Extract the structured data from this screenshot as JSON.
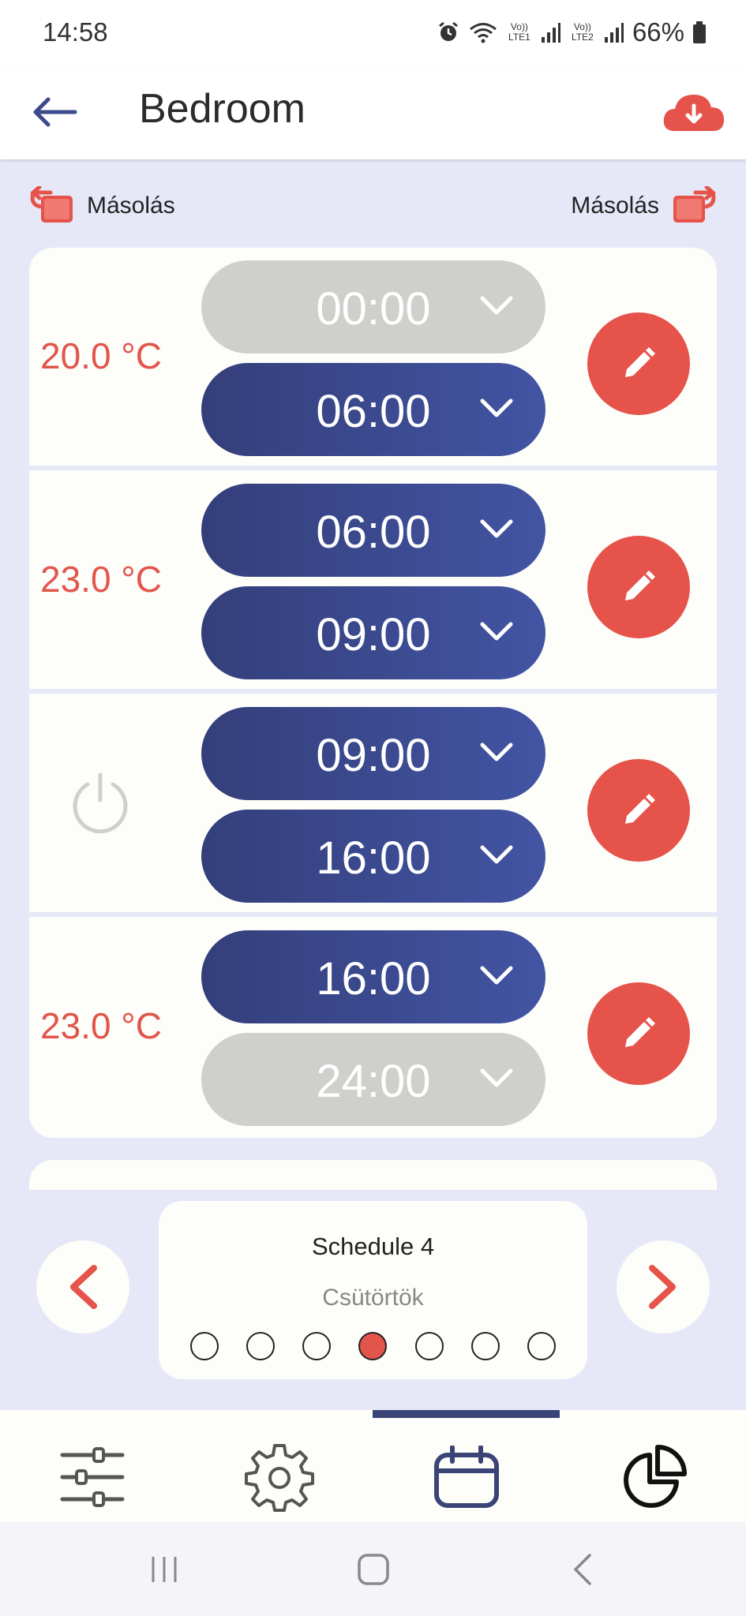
{
  "status": {
    "time": "14:58",
    "battery": "66%",
    "sim1": "Vo)) LTE1",
    "sim2": "Vo)) LTE2"
  },
  "header": {
    "title": "Bedroom",
    "back_icon": "arrow-left-icon",
    "cloud_icon": "cloud-download-icon"
  },
  "copy": {
    "left_label": "Másolás",
    "right_label": "Másolás"
  },
  "periods": [
    {
      "temp": "20.0 °C",
      "start": "00:00",
      "end": "06:00",
      "start_active": false,
      "end_active": true,
      "mode": "temp"
    },
    {
      "temp": "23.0 °C",
      "start": "06:00",
      "end": "09:00",
      "start_active": true,
      "end_active": true,
      "mode": "temp"
    },
    {
      "temp": "",
      "start": "09:00",
      "end": "16:00",
      "start_active": true,
      "end_active": true,
      "mode": "off"
    },
    {
      "temp": "23.0 °C",
      "start": "16:00",
      "end": "24:00",
      "start_active": true,
      "end_active": false,
      "mode": "temp"
    }
  ],
  "day_nav": {
    "schedule_name": "Schedule 4",
    "day_name": "Csütörtök",
    "days_count": 7,
    "active_day_index": 3
  },
  "bottom_nav": {
    "items": [
      "sliders-icon",
      "gear-icon",
      "calendar-icon",
      "pie-chart-icon"
    ],
    "active_index": 2
  },
  "colors": {
    "accent_red": "#e5534a",
    "active_pill": "#3b4a94",
    "inactive_pill": "#cfd0cc",
    "background": "#e6e8f7"
  }
}
